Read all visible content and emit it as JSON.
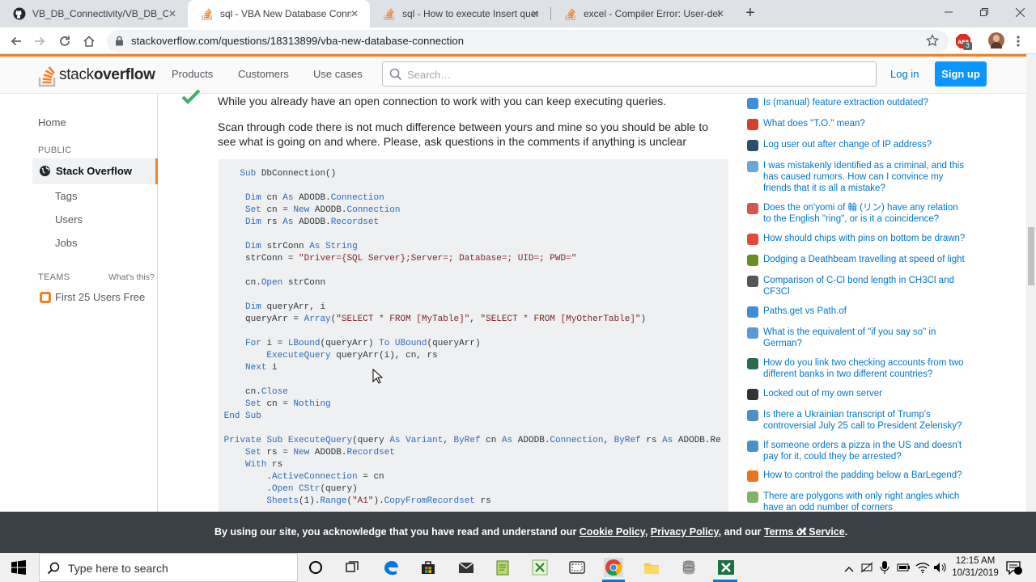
{
  "browser": {
    "tabs": [
      {
        "title": "VB_DB_Connectivity/VB_DB_Conn",
        "icon": "github-icon"
      },
      {
        "title": "sql - VBA New Database Connec",
        "icon": "stackoverflow-icon"
      },
      {
        "title": "sql - How to execute Insert query",
        "icon": "stackoverflow-icon"
      },
      {
        "title": "excel - Compiler Error: User-defin",
        "icon": "stackoverflow-icon"
      }
    ],
    "new_tab_label": "+",
    "url": "stackoverflow.com/questions/18313899/vba-new-database-connection",
    "profile_badge": "3"
  },
  "site": {
    "logo_text_light": "stack",
    "logo_text_bold": "overflow",
    "nav": [
      "Products",
      "Customers",
      "Use cases"
    ],
    "search_placeholder": "Search…",
    "login_label": "Log in",
    "signup_label": "Sign up"
  },
  "leftnav": {
    "home": "Home",
    "public_header": "PUBLIC",
    "stack_overflow": "Stack Overflow",
    "tags": "Tags",
    "users": "Users",
    "jobs": "Jobs",
    "teams_header": "TEAMS",
    "whats_this": "What's this?",
    "first_users": "First 25 Users Free"
  },
  "answer": {
    "para1": "While you already have an open connection to work with you can keep executing queries.",
    "para2": "Scan through code there is not much difference between yours and mine so you should be able to see what is going on and where. Please, ask questions in the comments if anything is unclear",
    "code_lines": [
      "    Sub DbConnection()",
      "",
      "     Dim cn As ADODB.Connection",
      "     Set cn = New ADODB.Connection",
      "     Dim rs As ADODB.Recordset",
      "",
      "     Dim strConn As String",
      "     strConn = \"Driver={SQL Server};Server=; Database=; UID=; PWD=\"",
      "",
      "     cn.Open strConn",
      "",
      "     Dim queryArr, i",
      "     queryArr = Array(\"SELECT * FROM [MyTable]\", \"SELECT * FROM [MyOtherTable]\")",
      "",
      "     For i = LBound(queryArr) To UBound(queryArr)",
      "         ExecuteQuery queryArr(i), cn, rs",
      "     Next i",
      "",
      "     cn.Close",
      "     Set cn = Nothing",
      " End Sub",
      "",
      " Private Sub ExecuteQuery(query As Variant, ByRef cn As ADODB.Connection, ByRef rs As ADODB.Re",
      "     Set rs = New ADODB.Recordset",
      "     With rs",
      "         .ActiveConnection = cn",
      "         .Open CStr(query)",
      "         Sheets(1).Range(\"A1\").CopyFromRecordset rs"
    ]
  },
  "hot_questions": [
    {
      "text": "Is (manual) feature extraction outdated?",
      "icon_color": "#3d8fd6"
    },
    {
      "text": "What does \"T.O.\" mean?",
      "icon_color": "#d4412b"
    },
    {
      "text": "Log user out after change of IP address?",
      "icon_color": "#2b4f6e"
    },
    {
      "text": "I was mistakenly identified as a criminal, and this has caused rumors. How can I convince my friends that it is all a mistake?",
      "icon_color": "#6aa7d8"
    },
    {
      "text": "Does the on'yomi of 輪 (リン) have any relation to the English \"ring\", or is it a coincidence?",
      "icon_color": "#d9534f"
    },
    {
      "text": "How should chips with pins on bottom be drawn?",
      "icon_color": "#e04c3c"
    },
    {
      "text": "Dodging a Deathbeam travelling at speed of light",
      "icon_color": "#6b8e23"
    },
    {
      "text": "Comparison of C-Cl bond length in CH3Cl and CF3Cl",
      "icon_color": "#555555"
    },
    {
      "text": "Paths.get vs Path.of",
      "icon_color": "#3d8fd6"
    },
    {
      "text": "What is the equivalent of \"if you say so\" in German?",
      "icon_color": "#5b9bd5"
    },
    {
      "text": "How do you link two checking accounts from two different banks in two different countries?",
      "icon_color": "#2b6b4f"
    },
    {
      "text": "Locked out of my own server",
      "icon_color": "#333333"
    },
    {
      "text": "Is there a Ukrainian transcript of Trump's controversial July 25 call to President Zelensky?",
      "icon_color": "#4a90c9"
    },
    {
      "text": "If someone orders a pizza in the US and doesn't pay for it, could they be arrested?",
      "icon_color": "#4a90c9"
    },
    {
      "text": "How to control the padding below a BarLegend?",
      "icon_color": "#e8741c"
    },
    {
      "text": "There are polygons with only right angles which have an odd number of corners",
      "icon_color": "#7fb36a"
    }
  ],
  "cookie_banner": {
    "prefix": "By using our site, you acknowledge that you have read and understand our ",
    "cookie_policy": "Cookie Policy",
    "sep1": ", ",
    "privacy_policy": "Privacy Policy",
    "sep2": ", and our ",
    "terms": "Terms of Service",
    "suffix": ".",
    "close_label": "✕"
  },
  "taskbar": {
    "search_placeholder": "Type here to search",
    "time": "12:15 AM",
    "date": "10/31/2019"
  },
  "colors": {
    "so_orange": "#f48024",
    "so_blue": "#0a95ff",
    "link_blue": "#0077cc",
    "accepted_green": "#48a868"
  }
}
